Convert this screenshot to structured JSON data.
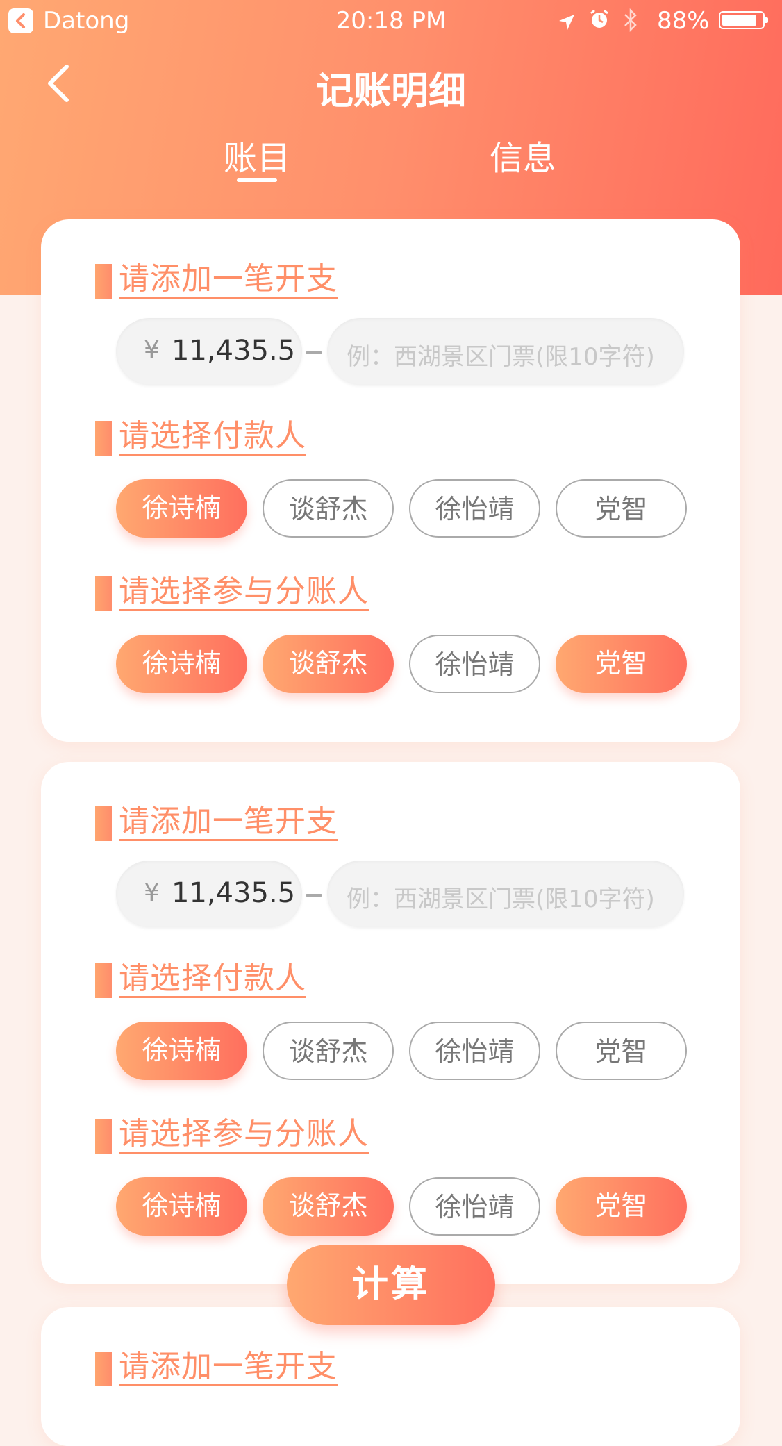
{
  "status_bar": {
    "carrier": "Datong",
    "time": "20:18 PM",
    "battery": "88%",
    "battery_level": 0.88
  },
  "nav": {
    "title": "记账明细",
    "back_icon": "chevron-left-icon"
  },
  "tabs": [
    {
      "label": "账目",
      "active": true
    },
    {
      "label": "信息",
      "active": false
    }
  ],
  "cards": [
    {
      "expense_title": "请添加一笔开支",
      "amount_currency": "¥",
      "amount_value": "11,435.5",
      "desc_placeholder": "例：西湖景区门票(限10字符)",
      "payer_title": "请选择付款人",
      "payers": [
        {
          "name": "徐诗楠",
          "selected": true
        },
        {
          "name": "谈舒杰",
          "selected": false
        },
        {
          "name": "徐怡靖",
          "selected": false
        },
        {
          "name": "党智",
          "selected": false
        }
      ],
      "participant_title": "请选择参与分账人",
      "participants": [
        {
          "name": "徐诗楠",
          "selected": true
        },
        {
          "name": "谈舒杰",
          "selected": true
        },
        {
          "name": "徐怡靖",
          "selected": false
        },
        {
          "name": "党智",
          "selected": true
        }
      ]
    },
    {
      "expense_title": "请添加一笔开支",
      "amount_currency": "¥",
      "amount_value": "11,435.5",
      "desc_placeholder": "例：西湖景区门票(限10字符)",
      "payer_title": "请选择付款人",
      "payers": [
        {
          "name": "徐诗楠",
          "selected": true
        },
        {
          "name": "谈舒杰",
          "selected": false
        },
        {
          "name": "徐怡靖",
          "selected": false
        },
        {
          "name": "党智",
          "selected": false
        }
      ],
      "participant_title": "请选择参与分账人",
      "participants": [
        {
          "name": "徐诗楠",
          "selected": true
        },
        {
          "name": "谈舒杰",
          "selected": true
        },
        {
          "name": "徐怡靖",
          "selected": false
        },
        {
          "name": "党智",
          "selected": true
        }
      ]
    },
    {
      "expense_title": "请添加一笔开支"
    }
  ],
  "calculate_button": "计算",
  "colors": {
    "accent": "#ff8f68",
    "gradient_start": "#ffa870",
    "gradient_end": "#ff6f5e",
    "background": "#fdf1ec"
  }
}
